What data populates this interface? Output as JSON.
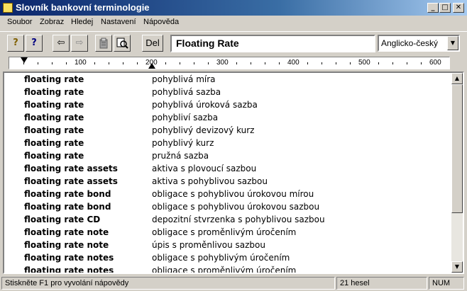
{
  "window": {
    "title": "Slovník bankovní terminologie",
    "minimize": "_",
    "maximize": "□",
    "close": "✕"
  },
  "menu": [
    "Soubor",
    "Zobraz",
    "Hledej",
    "Nastavení",
    "Nápověda"
  ],
  "toolbar": {
    "help_icon": "?",
    "context_help_icon": "?",
    "back_icon": "⇦",
    "forward_icon": "⇨",
    "clipboard_icon": "clipboard-icon",
    "search_doc_icon": "document-search-icon",
    "del_label": "Del",
    "search_value": "Floating Rate",
    "language_selected": "Anglicko-český",
    "dropdown_arrow": "▼"
  },
  "ruler": {
    "labels": [
      "100",
      "200",
      "300",
      "400",
      "500",
      "600"
    ]
  },
  "entries": [
    {
      "term": "floating rate",
      "translation": "pohyblivá míra"
    },
    {
      "term": "floating rate",
      "translation": "pohyblivá sazba"
    },
    {
      "term": "floating rate",
      "translation": "pohyblivá úroková sazba"
    },
    {
      "term": "floating rate",
      "translation": "pohybliví sazba"
    },
    {
      "term": "floating rate",
      "translation": "pohyblivý devizový kurz"
    },
    {
      "term": "floating rate",
      "translation": "pohyblivý kurz"
    },
    {
      "term": "floating rate",
      "translation": "pružná sazba"
    },
    {
      "term": "floating rate assets",
      "translation": "aktiva s plovoucí sazbou"
    },
    {
      "term": "floating rate assets",
      "translation": "aktiva s pohyblivou sazbou"
    },
    {
      "term": "floating rate bond",
      "translation": "obligace s pohyblivou úrokovou mírou"
    },
    {
      "term": "floating rate bond",
      "translation": "obligace s pohyblivou úrokovou sazbou"
    },
    {
      "term": "floating rate CD",
      "translation": "depozitní stvrzenka s pohyblivou sazbou"
    },
    {
      "term": "floating rate note",
      "translation": "obligace s proměnlivým úročením"
    },
    {
      "term": "floating rate note",
      "translation": "úpis s proměnlivou sazbou"
    },
    {
      "term": "floating rate notes",
      "translation": "obligace s pohyblivým úročením"
    },
    {
      "term": "floating rate notes",
      "translation": "obligace s proměnlivým úročením"
    }
  ],
  "scrollbar": {
    "up": "▲",
    "down": "▼"
  },
  "status": {
    "hint": "Stiskněte F1 pro vyvolání nápovědy",
    "count": "21 hesel",
    "empty": "",
    "num": "NUM"
  }
}
